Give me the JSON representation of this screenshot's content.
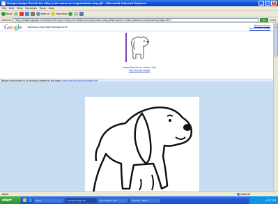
{
  "window": {
    "title": "Google Image Result for http://cdn.www.xxx.org/cartoon-dog.gif - Microsoft Internet Explorer",
    "minimize": "_",
    "maximize": "□",
    "close": "×"
  },
  "menu": [
    "File",
    "Edit",
    "View",
    "Favorites",
    "Tools",
    "Help"
  ],
  "toolbar": {
    "back": "Back",
    "search": "Search",
    "favorites": "Favorites"
  },
  "address": {
    "label": "Address",
    "url": "http://images.google.com/imgres?imgurl=http://cdn.www.xxx.org/cartoon-dog.gif&imgrefurl=http://www.xxx.org/coloring/dogs.html",
    "go": "Go",
    "links": "Links"
  },
  "google": {
    "logo": [
      "G",
      "o",
      "o",
      "g",
      "l",
      "e"
    ],
    "query_line": "www.xxx.org/coloring/dogs.html",
    "right_links": [
      "Remove frame",
      "See full-size image"
    ],
    "caption_line1": "Image Results for cartoon dog",
    "caption_line2": "See full-size image"
  },
  "info_strip": {
    "text": "Below is the image in its original context on the page:",
    "link": "www.xxx.org/coloring/dogs.html"
  },
  "status": {
    "left": "Done",
    "zone": "Internet"
  },
  "taskbar": {
    "start": "start",
    "tasks": [
      "Inbox",
      "Google Image Re...",
      "Document1 - Mi...",
      "Untitled - Paint"
    ],
    "clock": "4:37 PM"
  }
}
